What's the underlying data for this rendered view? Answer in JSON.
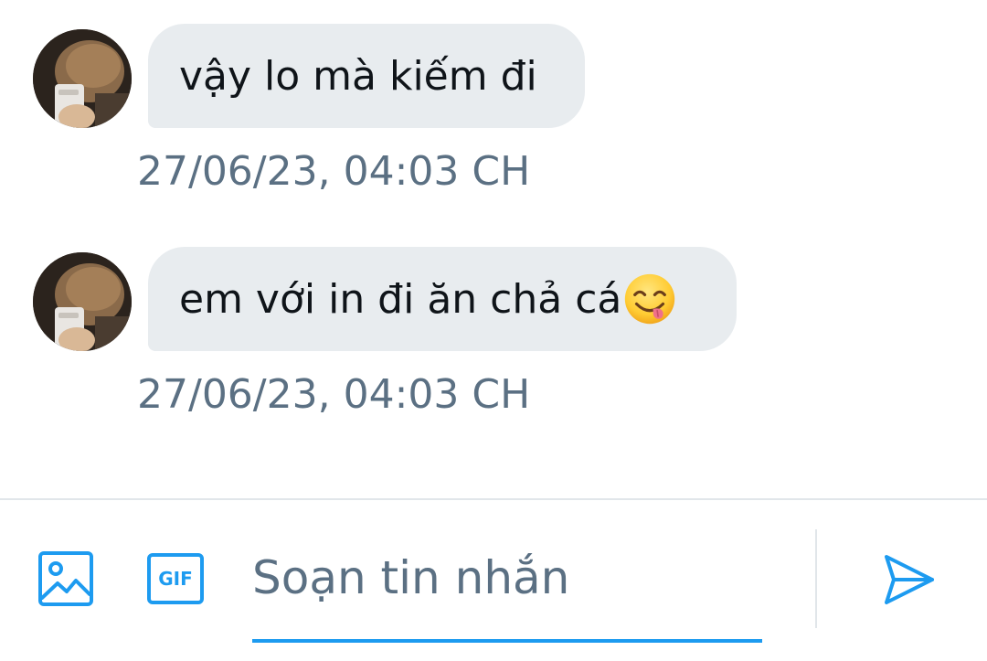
{
  "messages": [
    {
      "text": "vậy lo mà kiếm đi",
      "timestamp": "27/06/23, 04:03 CH",
      "emoji": null
    },
    {
      "text": "em với in đi ăn chả cá",
      "timestamp": "27/06/23, 04:03 CH",
      "emoji": "face-savoring-food-emoji"
    }
  ],
  "composer": {
    "media_icon": "image-icon",
    "gif_label": "GIF",
    "placeholder": "Soạn tin nhắn",
    "value": "",
    "send_icon": "send-icon"
  },
  "colors": {
    "accent": "#1d9bf0",
    "bubble_background": "#e8ecef",
    "message_text": "#0f1419",
    "secondary_text": "#5b7083",
    "divider": "#e1e6ea"
  }
}
